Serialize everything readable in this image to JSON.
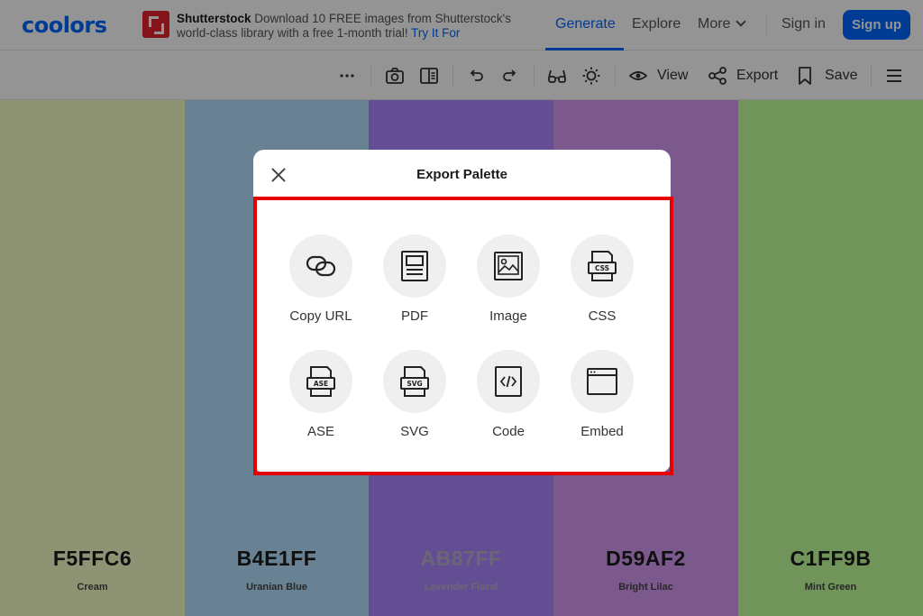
{
  "brand": {
    "logo": "coolors",
    "color": "#0066ff"
  },
  "ad": {
    "brand": "Shutterstock",
    "text": "Download 10 FREE images from Shutterstock's world-class library with a free 1-month trial!",
    "link": "Try It For"
  },
  "nav": {
    "generate": "Generate",
    "explore": "Explore",
    "more": "More",
    "signin": "Sign in",
    "signup": "Sign up"
  },
  "toolbar": {
    "icons": [
      "more-icon",
      "camera-icon",
      "layout-icon",
      "undo-icon",
      "redo-icon",
      "glasses-icon",
      "brightness-icon",
      "eye-icon",
      "share-icon",
      "bookmark-icon",
      "menu-icon"
    ],
    "view": "View",
    "export": "Export",
    "save": "Save"
  },
  "palette": [
    {
      "hex": "F5FFC6",
      "name": "Cream",
      "color": "#F5FFC6"
    },
    {
      "hex": "B4E1FF",
      "name": "Uranian Blue",
      "color": "#B4E1FF"
    },
    {
      "hex": "AB87FF",
      "name": "Lavender Floral",
      "color": "#AB87FF"
    },
    {
      "hex": "D59AF2",
      "name": "Bright Lilac",
      "color": "#D59AF2"
    },
    {
      "hex": "C1FF9B",
      "name": "Mint Green",
      "color": "#C1FF9B"
    }
  ],
  "modal": {
    "title": "Export Palette",
    "options": [
      {
        "label": "Copy URL",
        "icon": "link-icon"
      },
      {
        "label": "PDF",
        "icon": "pdf-icon"
      },
      {
        "label": "Image",
        "icon": "image-icon"
      },
      {
        "label": "CSS",
        "icon": "css-file-icon",
        "badge": "CSS"
      },
      {
        "label": "ASE",
        "icon": "ase-file-icon",
        "badge": "ASE"
      },
      {
        "label": "SVG",
        "icon": "svg-file-icon",
        "badge": "SVG"
      },
      {
        "label": "Code",
        "icon": "code-icon"
      },
      {
        "label": "Embed",
        "icon": "embed-icon"
      }
    ]
  }
}
